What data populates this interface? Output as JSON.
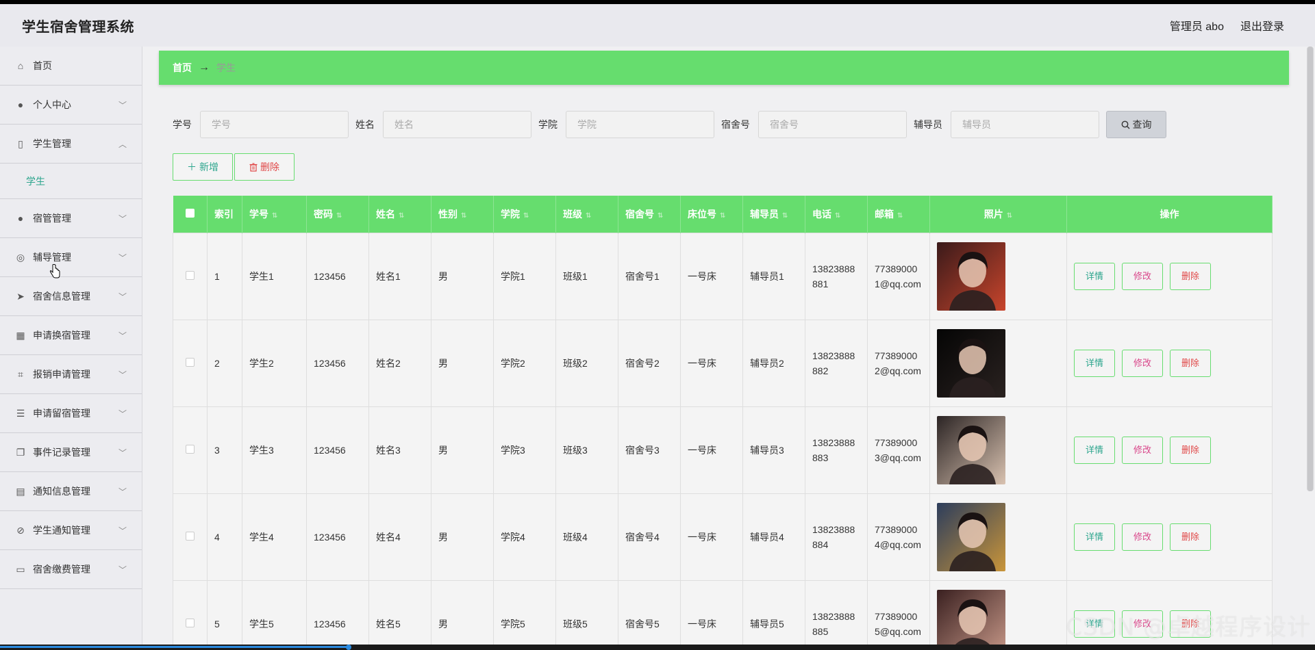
{
  "app": {
    "title": "学生宿舍管理系统"
  },
  "header": {
    "user_label": "管理员 abo",
    "logout_label": "退出登录"
  },
  "sidebar": {
    "items": [
      {
        "label": "首页",
        "icon": "home-icon",
        "expandable": false
      },
      {
        "label": "个人中心",
        "icon": "user-icon",
        "expandable": true
      },
      {
        "label": "学生管理",
        "icon": "badge-icon",
        "expandable": true,
        "expanded": true,
        "children": [
          {
            "label": "学生",
            "active": true
          }
        ]
      },
      {
        "label": "宿管管理",
        "icon": "bulb-icon",
        "expandable": true
      },
      {
        "label": "辅导管理",
        "icon": "support-icon",
        "expandable": true
      },
      {
        "label": "宿舍信息管理",
        "icon": "send-icon",
        "expandable": true
      },
      {
        "label": "申请换宿管理",
        "icon": "grid-icon",
        "expandable": true
      },
      {
        "label": "报销申请管理",
        "icon": "crop-icon",
        "expandable": true
      },
      {
        "label": "申请留宿管理",
        "icon": "list-icon",
        "expandable": true
      },
      {
        "label": "事件记录管理",
        "icon": "copy-icon",
        "expandable": true
      },
      {
        "label": "通知信息管理",
        "icon": "clipboard-icon",
        "expandable": true
      },
      {
        "label": "学生通知管理",
        "icon": "compass-icon",
        "expandable": true
      },
      {
        "label": "宿舍缴费管理",
        "icon": "message-icon",
        "expandable": true
      }
    ]
  },
  "breadcrumb": {
    "home": "首页",
    "separator": "→",
    "current": "学生"
  },
  "search": {
    "fields": [
      {
        "label": "学号",
        "placeholder": "学号",
        "value": ""
      },
      {
        "label": "姓名",
        "placeholder": "姓名",
        "value": ""
      },
      {
        "label": "学院",
        "placeholder": "学院",
        "value": ""
      },
      {
        "label": "宿舍号",
        "placeholder": "宿舍号",
        "value": ""
      },
      {
        "label": "辅导员",
        "placeholder": "辅导员",
        "value": ""
      }
    ],
    "query_label": "查询"
  },
  "actions": {
    "add_label": "新增",
    "delete_label": "删除"
  },
  "table": {
    "headers": {
      "index": "索引",
      "student_no": "学号",
      "password": "密码",
      "name": "姓名",
      "gender": "性别",
      "college": "学院",
      "class": "班级",
      "dorm_no": "宿舍号",
      "bed_no": "床位号",
      "counselor": "辅导员",
      "phone": "电话",
      "email": "邮箱",
      "photo": "照片",
      "operations": "操作"
    },
    "op_labels": {
      "detail": "详情",
      "edit": "修改",
      "delete": "删除"
    },
    "rows": [
      {
        "index": "1",
        "student_no": "学生1",
        "password": "123456",
        "name": "姓名1",
        "gender": "男",
        "college": "学院1",
        "class": "班级1",
        "dorm_no": "宿舍号1",
        "bed_no": "一号床",
        "counselor": "辅导员1",
        "phone": "13823888881",
        "email": "773890001@qq.com",
        "photo_colors": [
          "#3a1a1a",
          "#c8452c"
        ]
      },
      {
        "index": "2",
        "student_no": "学生2",
        "password": "123456",
        "name": "姓名2",
        "gender": "男",
        "college": "学院2",
        "class": "班级2",
        "dorm_no": "宿舍号2",
        "bed_no": "一号床",
        "counselor": "辅导员2",
        "phone": "13823888882",
        "email": "773890002@qq.com",
        "photo_colors": [
          "#050505",
          "#2a2220"
        ]
      },
      {
        "index": "3",
        "student_no": "学生3",
        "password": "123456",
        "name": "姓名3",
        "gender": "男",
        "college": "学院3",
        "class": "班级3",
        "dorm_no": "宿舍号3",
        "bed_no": "一号床",
        "counselor": "辅导员3",
        "phone": "13823888883",
        "email": "773890003@qq.com",
        "photo_colors": [
          "#2b2424",
          "#d9c2b0"
        ]
      },
      {
        "index": "4",
        "student_no": "学生4",
        "password": "123456",
        "name": "姓名4",
        "gender": "男",
        "college": "学院4",
        "class": "班级4",
        "dorm_no": "宿舍号4",
        "bed_no": "一号床",
        "counselor": "辅导员4",
        "phone": "13823888884",
        "email": "773890004@qq.com",
        "photo_colors": [
          "#2c3d5c",
          "#c9953a"
        ]
      },
      {
        "index": "5",
        "student_no": "学生5",
        "password": "123456",
        "name": "姓名5",
        "gender": "男",
        "college": "学院5",
        "class": "班级5",
        "dorm_no": "宿舍号5",
        "bed_no": "一号床",
        "counselor": "辅导员5",
        "phone": "13823888885",
        "email": "773890005@qq.com",
        "photo_colors": [
          "#3a2020",
          "#c99a8a"
        ]
      }
    ]
  },
  "watermark": "CSDN @卓越程序设计",
  "video": {
    "progress": 0.265
  },
  "colors": {
    "accent": "#66dd6e",
    "link": "#2ca58d",
    "danger": "#e04848",
    "edit": "#d9468a"
  }
}
